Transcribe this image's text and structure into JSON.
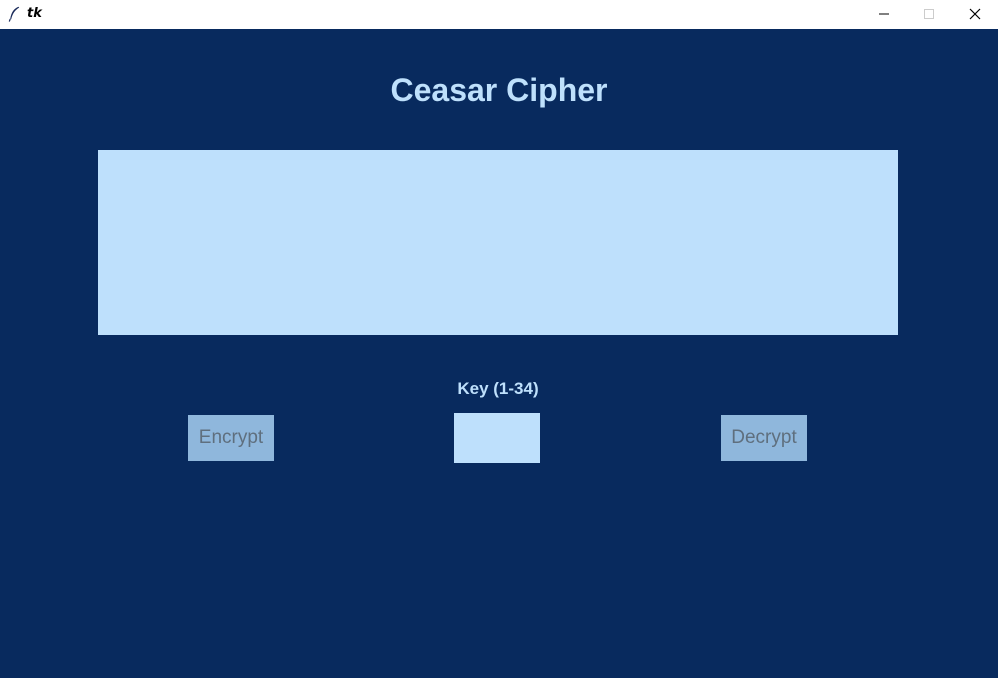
{
  "window": {
    "title": "tk",
    "controls": [
      "minimize",
      "maximize",
      "close"
    ]
  },
  "app": {
    "heading": "Ceasar Cipher",
    "text_area": {
      "value": ""
    },
    "key": {
      "label": "Key (1-34)",
      "value": ""
    },
    "buttons": {
      "encrypt": "Encrypt",
      "decrypt": "Decrypt"
    }
  },
  "colors": {
    "background": "#082a5e",
    "accent_light": "#bee0fc",
    "button_bg": "#8fb7dc",
    "button_text": "#5f6f7e"
  }
}
